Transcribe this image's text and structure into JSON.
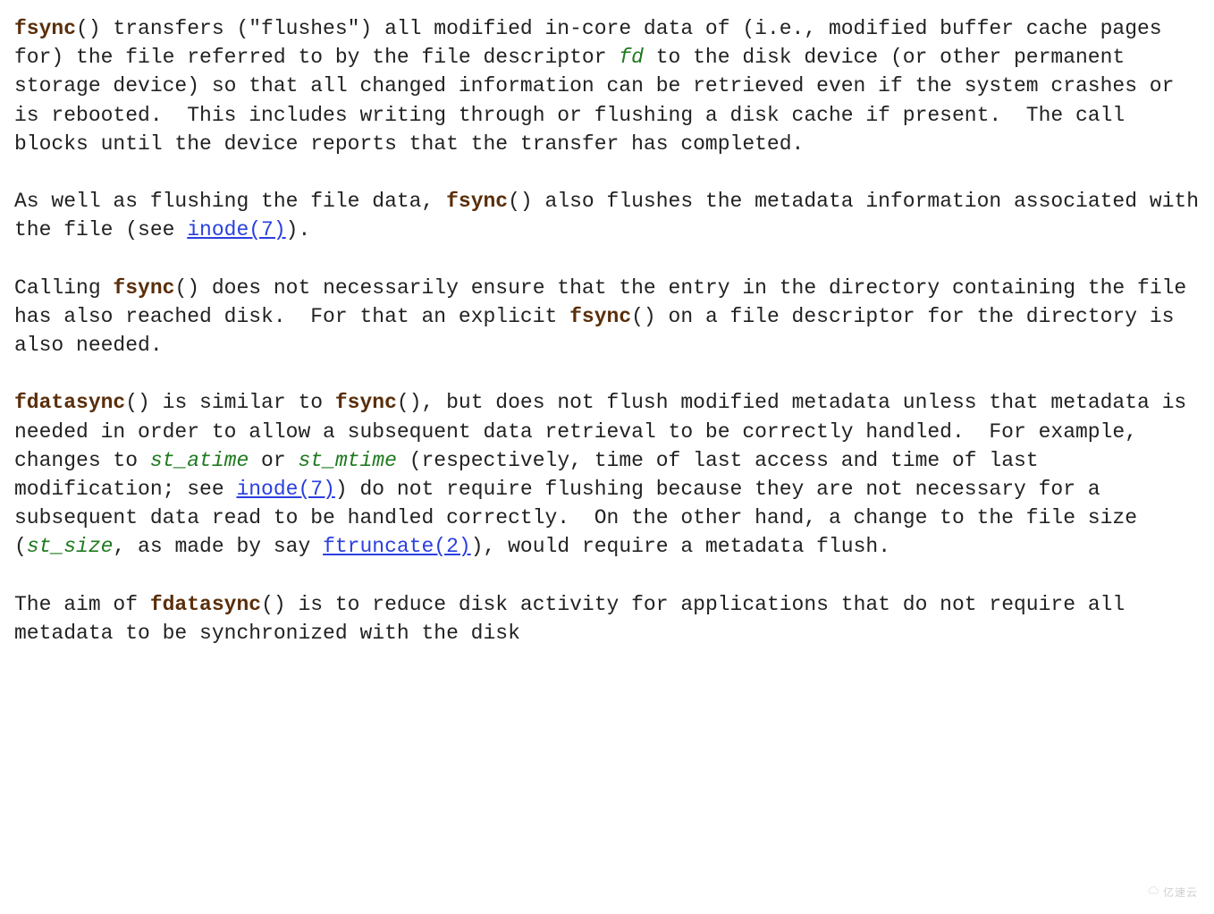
{
  "colors": {
    "bold": "#5a2e0a",
    "italic": "#1f7a1f",
    "link": "#2a3fe0"
  },
  "watermark": "亿速云",
  "paragraphs": {
    "p1": {
      "s1a": "fsync",
      "s1b": "() transfers (\"flushes\") all modified in-core data of (i.e., modified buffer cache pages for) the file referred to by the file descriptor ",
      "s1c": "fd",
      "s1d": " to the disk device (or other permanent storage device) so that all changed information can be retrieved even if the system crashes or is rebooted.  This includes writing through or flushing a disk cache if present.  The call blocks until the device reports that the transfer has completed."
    },
    "p2": {
      "s2a": "As well as flushing the file data, ",
      "s2b": "fsync",
      "s2c": "() also flushes the metadata information associated with the file (see ",
      "s2d": "inode(7)",
      "s2e": ")."
    },
    "p3": {
      "s3a": "Calling ",
      "s3b": "fsync",
      "s3c": "() does not necessarily ensure that the entry in the directory containing the file has also reached disk.  For that an explicit ",
      "s3d": "fsync",
      "s3e": "() on a file descriptor for the directory is also needed."
    },
    "p4": {
      "s4a": "fdatasync",
      "s4b": "() is similar to ",
      "s4c": "fsync",
      "s4d": "(), but does not flush modified metadata unless that metadata is needed in order to allow a subsequent data retrieval to be correctly handled.  For example, changes to ",
      "s4e": "st_atime",
      "s4f": " or ",
      "s4g": "st_mtime",
      "s4h": " (respectively, time of last access and time of last modification; see ",
      "s4i": "inode(7)",
      "s4j": ") do not require flushing because they are not necessary for a subsequent data read to be handled correctly.  On the other hand, a change to the file size (",
      "s4k": "st_size",
      "s4l": ", as made by say ",
      "s4m": "ftruncate(2)",
      "s4n": "), would require a metadata flush."
    },
    "p5": {
      "s5a": "The aim of ",
      "s5b": "fdatasync",
      "s5c": "() is to reduce disk activity for applications that do not require all metadata to be synchronized with the disk"
    }
  }
}
